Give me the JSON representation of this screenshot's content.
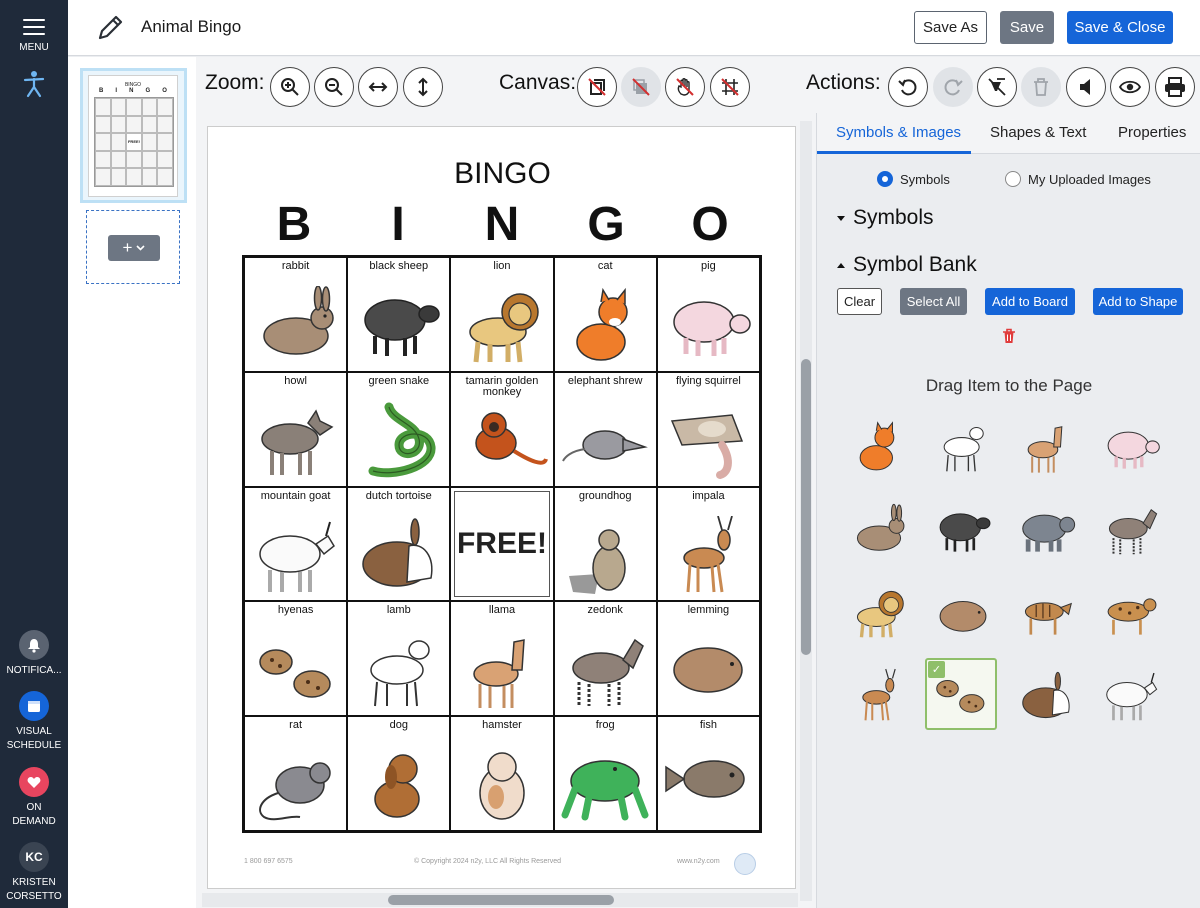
{
  "rail": {
    "menu_label": "MENU",
    "notifications_label": "NOTIFICA...",
    "schedule_label_1": "VISUAL",
    "schedule_label_2": "SCHEDULE",
    "ondemand_label_1": "ON",
    "ondemand_label_2": "DEMAND",
    "user_initials": "KC",
    "user_name_1": "KRISTEN",
    "user_name_2": "CORSETTO"
  },
  "header": {
    "title": "Animal Bingo",
    "save_as": "Save As",
    "save": "Save",
    "save_close": "Save & Close"
  },
  "toolbar": {
    "zoom_label": "Zoom:",
    "canvas_label": "Canvas:",
    "actions_label": "Actions:"
  },
  "thumbnail": {
    "title": "BINGO",
    "letters": [
      "B",
      "I",
      "N",
      "G",
      "O"
    ],
    "free": "FREE!"
  },
  "page": {
    "title": "BINGO",
    "letters": [
      "B",
      "I",
      "N",
      "G",
      "O"
    ],
    "cells": [
      "rabbit",
      "black sheep",
      "lion",
      "cat",
      "pig",
      "howl",
      "green snake",
      "tamarin golden monkey",
      "elephant shrew",
      "flying squirrel",
      "mountain goat",
      "dutch tortoise",
      "FREE!",
      "groundhog",
      "impala",
      "hyenas",
      "lamb",
      "llama",
      "zedonk",
      "lemming",
      "rat",
      "dog",
      "hamster",
      "frog",
      "fish"
    ],
    "footer_phone": "1 800 697 6575",
    "footer_copyright": "© Copyright 2024 n2y, LLC All Rights Reserved",
    "footer_url": "www.n2y.com"
  },
  "panel": {
    "tabs": [
      "Symbols & Images",
      "Shapes & Text",
      "Properties"
    ],
    "active_tab": "Symbols & Images",
    "radio_symbols": "Symbols",
    "radio_uploaded": "My Uploaded Images",
    "section_symbols": "Symbols",
    "section_bank": "Symbol Bank",
    "btn_clear": "Clear",
    "btn_select_all": "Select All",
    "btn_add_board": "Add to Board",
    "btn_add_shape": "Add to Shape",
    "drag_heading": "Drag Item to the Page",
    "bank_items": [
      "cat",
      "lamb",
      "llama",
      "pig",
      "rabbit",
      "black sheep",
      "bear",
      "zedonk",
      "lion",
      "lemming",
      "thylacine",
      "spotted cat",
      "impala",
      "hyenas",
      "dutch rabbit",
      "mountain goat"
    ],
    "selected_item": "hyenas"
  },
  "colors": {
    "primary": "#1565d8",
    "rail": "#1f2a3a",
    "secondary_button": "#6d7683",
    "notification": "#5a6371",
    "schedule": "#1565d8",
    "ondemand": "#e8455f"
  }
}
